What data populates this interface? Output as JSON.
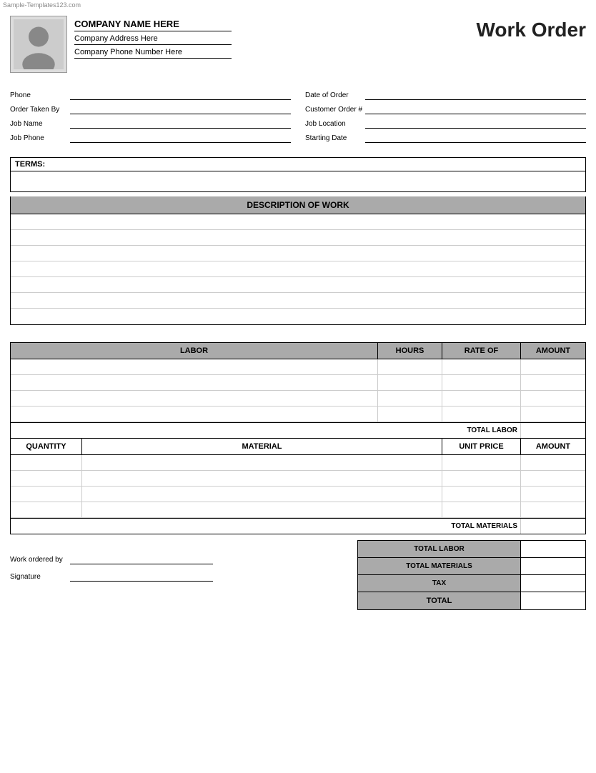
{
  "watermark": "Sample-Templates123.com",
  "header": {
    "company_name": "COMPANY NAME HERE",
    "company_address": "Company Address Here",
    "company_phone": "Company Phone Number Here",
    "title": "Work Order"
  },
  "form": {
    "left": [
      {
        "label": "Phone",
        "value": ""
      },
      {
        "label": "Order Taken By",
        "value": ""
      },
      {
        "label": "Job Name",
        "value": ""
      },
      {
        "label": "Job Phone",
        "value": ""
      }
    ],
    "right": [
      {
        "label": "Date of Order",
        "value": ""
      },
      {
        "label": "Customer Order #",
        "value": ""
      },
      {
        "label": "Job Location",
        "value": ""
      },
      {
        "label": "Starting Date",
        "value": ""
      }
    ]
  },
  "terms": {
    "label": "TERMS:"
  },
  "description_of_work": {
    "header": "DESCRIPTION OF WORK",
    "rows": 7
  },
  "labor": {
    "headers": [
      "LABOR",
      "HOURS",
      "RATE OF",
      "AMOUNT"
    ],
    "rows": 4,
    "total_label": "TOTAL LABOR"
  },
  "materials": {
    "headers": [
      "QUANTITY",
      "MATERIAL",
      "UNIT PRICE",
      "AMOUNT"
    ],
    "rows": 4,
    "total_label": "TOTAL MATERIALS"
  },
  "summary": {
    "rows": [
      {
        "label": "TOTAL LABOR",
        "value": ""
      },
      {
        "label": "TOTAL MATERIALS",
        "value": ""
      },
      {
        "label": "TAX",
        "value": ""
      },
      {
        "label": "TOTAL",
        "value": ""
      }
    ]
  },
  "footer": {
    "work_ordered_by_label": "Work ordered by",
    "signature_label": "Signature"
  }
}
